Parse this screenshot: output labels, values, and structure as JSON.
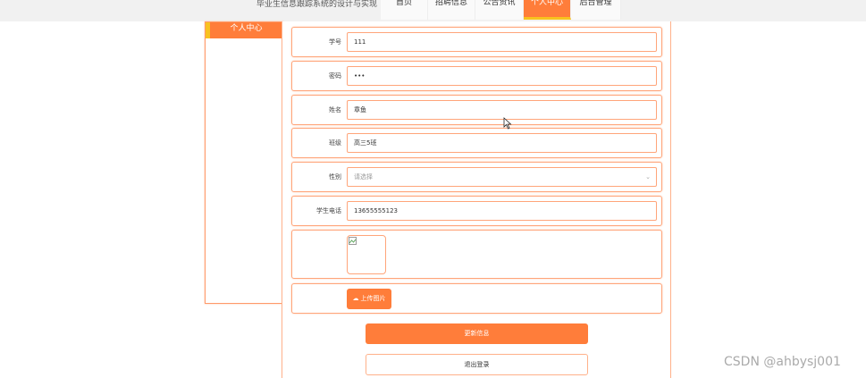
{
  "header": {
    "site_title": "毕业生信息跟踪系统的设计与实现",
    "nav": [
      {
        "label": "首页"
      },
      {
        "label": "招聘信息"
      },
      {
        "label": "公告资讯"
      },
      {
        "label": "个人中心",
        "active": true
      },
      {
        "label": "后台管理"
      }
    ]
  },
  "sidebar": {
    "heading": "个人中心"
  },
  "form": {
    "student_id": {
      "label": "学号",
      "value": "111"
    },
    "password": {
      "label": "密码",
      "value": "•••"
    },
    "name": {
      "label": "姓名",
      "value": "章鱼"
    },
    "class": {
      "label": "班级",
      "value": "高三5班"
    },
    "gender": {
      "label": "性别",
      "placeholder": "请选择"
    },
    "phone": {
      "label": "学生电话",
      "value": "13655555123"
    },
    "upload_label": "上传图片",
    "update_button": "更新信息",
    "logout_button": "退出登录"
  },
  "colors": {
    "accent": "#ff7d3a",
    "highlight": "#f8c21f",
    "border": "#ffa57a"
  },
  "watermark": "CSDN @ahbysj001"
}
